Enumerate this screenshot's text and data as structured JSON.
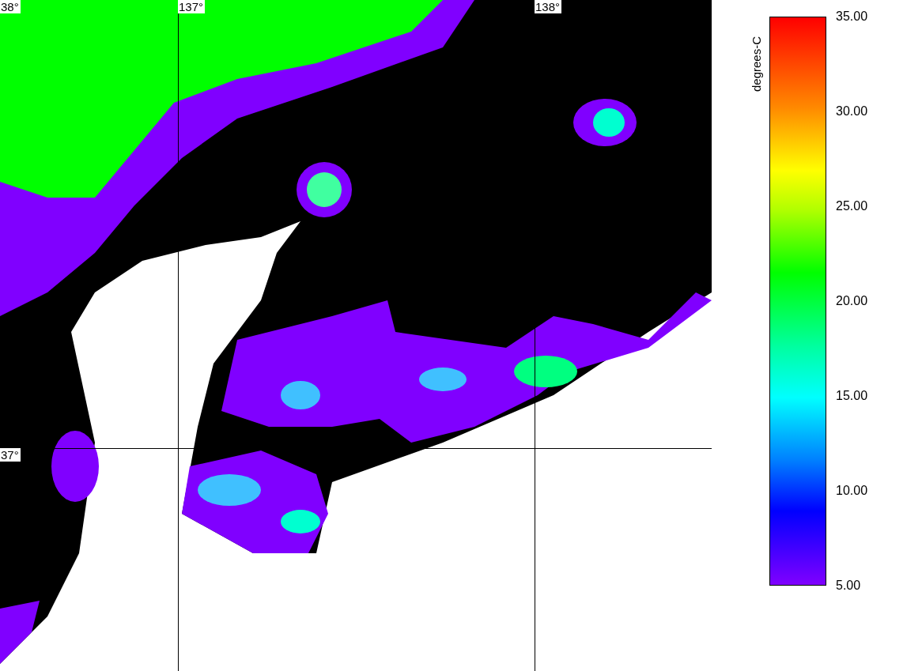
{
  "map": {
    "lat_labels": [
      "38°",
      "37°"
    ],
    "lon_labels": [
      "137°",
      "138°"
    ]
  },
  "colorbar": {
    "unit": "degrees-C",
    "ticks": [
      "35.00",
      "30.00",
      "25.00",
      "20.00",
      "15.00",
      "10.00",
      "5.00"
    ]
  }
}
